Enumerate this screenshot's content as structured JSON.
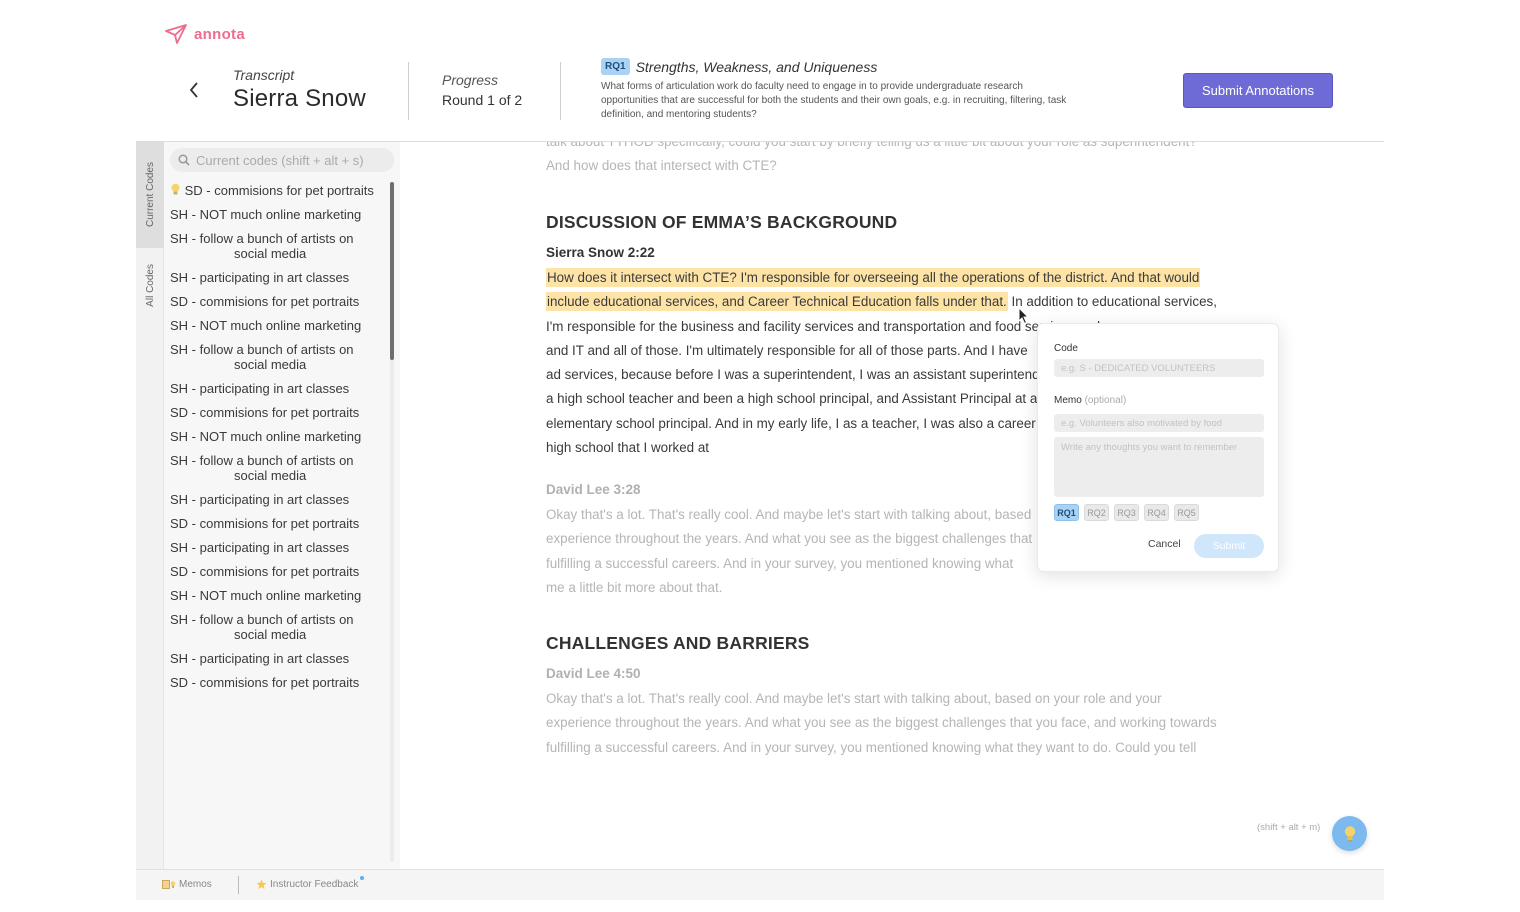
{
  "app": {
    "name": "annota"
  },
  "header": {
    "transcript_label": "Transcript",
    "transcript_name": "Sierra Snow",
    "progress_label": "Progress",
    "progress_value": "Round 1 of 2",
    "rq_badge": "RQ1",
    "rq_title": "Strengths, Weakness, and Uniqueness",
    "rq_description": "What forms of articulation work do faculty need to engage in to provide undergraduate research opportunities that are successful for both the students and their own goals, e.g. in recruiting, filtering, task definition, and mentoring students?",
    "submit_label": "Submit Annotations"
  },
  "rail": {
    "tab_current": "Current Codes",
    "tab_all": "All Codes"
  },
  "sidebar": {
    "search_placeholder": "Current codes (shift + alt + s)",
    "items": [
      "SD - commisions for pet portraits",
      "SH - NOT much online marketing",
      "SH - follow a bunch of artists on",
      "social media",
      "SH - participating in art classes",
      "SD - commisions for pet portraits",
      "SH - NOT much online marketing",
      "SH - follow a bunch of artists on",
      "social media",
      "SH - participating in art classes",
      "SD - commisions for pet portraits",
      "SH - NOT much online marketing",
      "SH - follow a bunch of artists on",
      "social media",
      "SH - participating in art classes",
      "SD - commisions for pet portraits",
      "SH - participating in art classes",
      "SD - commisions for pet portraits",
      "SH - NOT much online marketing",
      "SH - follow a bunch of artists on",
      "social media",
      "SH - participating in art classes",
      "SD - commisions for pet portraits"
    ]
  },
  "transcript": {
    "top_line1": "talk about TTHOD specifically, could you start by briefly telling us a little bit about your role as superintendent?",
    "top_line2": "And how does that intersect with CTE?",
    "section1_title": "DISCUSSION OF EMMA’S BACKGROUND",
    "speaker1": "Sierra Snow  2:22",
    "hl_line1": "How does it intersect with CTE? I'm responsible for overseeing all the operations of the district. And that would",
    "hl_line2": "include educational services, and Career Technical Education falls under that.",
    "after_hl": " In addition to educational services,",
    "p1_l3": "I'm responsible for the business and facility services and transportation and food services and",
    "p1_l4": "and IT and all of those. I'm ultimately responsible for all of those parts. And I have",
    "p1_l5": "ad services, because before I was a superintendent, I was an assistant superintendent",
    "p1_l6": "a high school teacher and been a high school principal, and Assistant Principal at a",
    "p1_l7": "elementary school principal. And in my early life, I as a teacher, I was also a career",
    "p1_l8": "high school that I worked at",
    "speaker2": "David Lee  3:28",
    "p2_l1": "Okay that's a lot. That's really cool. And maybe let's start with talking about, based",
    "p2_l2": "experience throughout the years. And what you see as the biggest challenges that",
    "p2_l3": "fulfilling a successful careers. And in your survey, you mentioned knowing what",
    "p2_l4": "me a little bit more about that.",
    "section2_title": "CHALLENGES AND BARRIERS",
    "speaker3": "David Lee  4:50",
    "p3_l1": "Okay that's a lot. That's really cool. And maybe let's start with talking about, based on your role and your",
    "p3_l2": "experience throughout the years. And what you see as the biggest challenges that you face, and working towards",
    "p3_l3": "fulfilling a successful careers. And in your survey, you mentioned knowing what they want to do. Could you tell"
  },
  "popover": {
    "code_label": "Code",
    "code_placeholder": "e.g. S - DEDICATED VOLUNTEERS",
    "memo_label": "Memo",
    "memo_optional": "(optional)",
    "memo_placeholder": "e.g. Volunteers also motivated by food",
    "thoughts_placeholder": "Write any thoughts you want to remember",
    "rq_chips": [
      "RQ1",
      "RQ2",
      "RQ3",
      "RQ4",
      "RQ5"
    ],
    "cancel_label": "Cancel",
    "submit_label": "Submit"
  },
  "footer": {
    "shortcut_hint": "(shift + alt + m)",
    "memos_label": "Memos",
    "feedback_label": "Instructor Feedback"
  },
  "colors": {
    "brand": "#ee6c8c",
    "primary": "#6e6bd6",
    "highlight": "#fde4a6",
    "rq_active": "#a9d2f5",
    "fab": "#7bb9ef"
  }
}
